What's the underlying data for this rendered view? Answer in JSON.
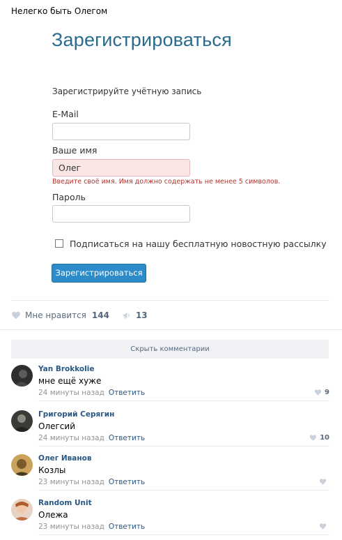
{
  "post": {
    "title": "Нелегко быть Олегом"
  },
  "form": {
    "heading": "Зарегистрироваться",
    "subtitle": "Зарегистрируйте учётную запись",
    "email_label": "E-Mail",
    "email_value": "",
    "name_label": "Ваше имя",
    "name_value": "Олег",
    "name_error": "Введите своё имя. Имя должно содержать не менее 5 символов.",
    "password_label": "Пароль",
    "password_value": "",
    "newsletter_label": "Подписаться на нашу бесплатную новостную рассылку",
    "newsletter_checked": false,
    "submit_label": "Зарегистрироваться"
  },
  "actions": {
    "like_label": "Мне нравится",
    "like_count": "144",
    "share_count": "13"
  },
  "comments_toggle": "Скрыть комментарии",
  "comments": [
    {
      "author": "Yan Brokkolie",
      "text": "мне ещё хуже",
      "time": "24 минуты назад",
      "reply": "Ответить",
      "likes": "9"
    },
    {
      "author": "Григорий Серягин",
      "text": "Олегсий",
      "time": "24 минуты назад",
      "reply": "Ответить",
      "likes": "10"
    },
    {
      "author": "Олег Иванов",
      "text": "Козлы",
      "time": "23 минуты назад",
      "reply": "Ответить",
      "likes": ""
    },
    {
      "author": "Random Unit",
      "text": "Олежа",
      "time": "23 минуты назад",
      "reply": "Ответить",
      "likes": ""
    }
  ],
  "colors": {
    "heading": "#2a6a8d",
    "error": "#b0342e",
    "button": "#2c8bc8",
    "link": "#2a5885"
  },
  "icons": {
    "like": "heart-icon",
    "share": "megaphone-icon",
    "comment_like": "heart-icon"
  }
}
